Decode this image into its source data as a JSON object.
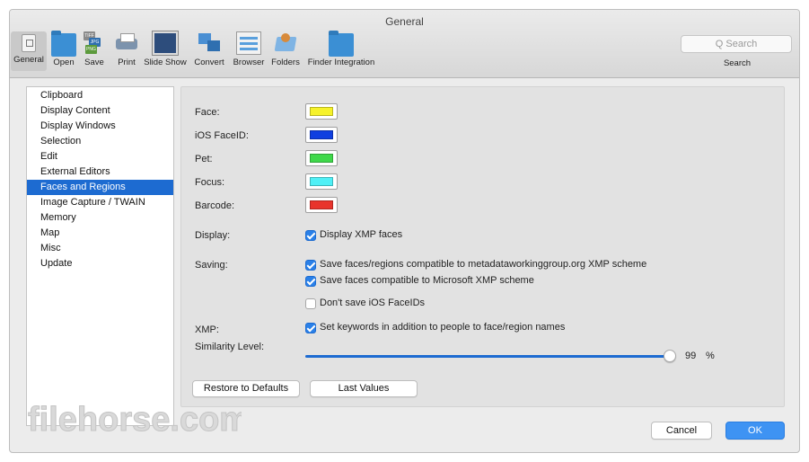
{
  "window": {
    "title": "General"
  },
  "toolbar": {
    "items": [
      {
        "label": "General",
        "icon": "general-doc-icon",
        "selected": true
      },
      {
        "label": "Open",
        "icon": "open-folder-icon"
      },
      {
        "label": "Save",
        "icon": "save-files-icon"
      },
      {
        "label": "Print",
        "icon": "printer-icon"
      },
      {
        "label": "Slide Show",
        "icon": "slide-show-icon"
      },
      {
        "label": "Convert",
        "icon": "convert-icon"
      },
      {
        "label": "Browser",
        "icon": "browser-icon"
      },
      {
        "label": "Folders",
        "icon": "folders-icon"
      },
      {
        "label": "Finder Integration",
        "icon": "finder-folder-icon"
      }
    ],
    "file_badges": [
      "TIFF",
      "JPG",
      "PNG"
    ],
    "search": {
      "placeholder": "Q Search",
      "label": "Search"
    }
  },
  "sidebar": {
    "items": [
      {
        "label": "Clipboard"
      },
      {
        "label": "Display Content"
      },
      {
        "label": "Display Windows"
      },
      {
        "label": "Selection"
      },
      {
        "label": "Edit"
      },
      {
        "label": "External Editors"
      },
      {
        "label": "Faces and Regions",
        "selected": true
      },
      {
        "label": "Image Capture / TWAIN"
      },
      {
        "label": "Memory"
      },
      {
        "label": "Map"
      },
      {
        "label": "Misc"
      },
      {
        "label": "Update"
      }
    ]
  },
  "panel": {
    "colors": [
      {
        "label": "Face:",
        "color": "#f6f22a"
      },
      {
        "label": "iOS FaceID:",
        "color": "#0f3fe0"
      },
      {
        "label": "Pet:",
        "color": "#3fd84a"
      },
      {
        "label": "Focus:",
        "color": "#4ff0f6"
      },
      {
        "label": "Barcode:",
        "color": "#e8342c"
      }
    ],
    "display_label": "Display:",
    "display_xmp": {
      "label": "Display XMP faces",
      "checked": true
    },
    "saving_label": "Saving:",
    "saving_options": [
      {
        "label": "Save faces/regions compatible to metadataworkinggroup.org XMP scheme",
        "checked": true
      },
      {
        "label": "Save faces compatible to Microsoft XMP scheme",
        "checked": true
      },
      {
        "label": "Don't save iOS FaceIDs",
        "checked": false
      }
    ],
    "xmp_label": "XMP:",
    "xmp_option": {
      "label": "Set keywords in addition to people to face/region names",
      "checked": true
    },
    "similarity": {
      "label": "Similarity Level:",
      "value": "99",
      "unit": "%"
    },
    "restore_button": "Restore to Defaults",
    "last_values_button": "Last Values"
  },
  "footer": {
    "cancel_button": "Cancel",
    "ok_button": "OK",
    "watermark": "filehorse.com"
  },
  "accent_color": "#1d6bd1"
}
